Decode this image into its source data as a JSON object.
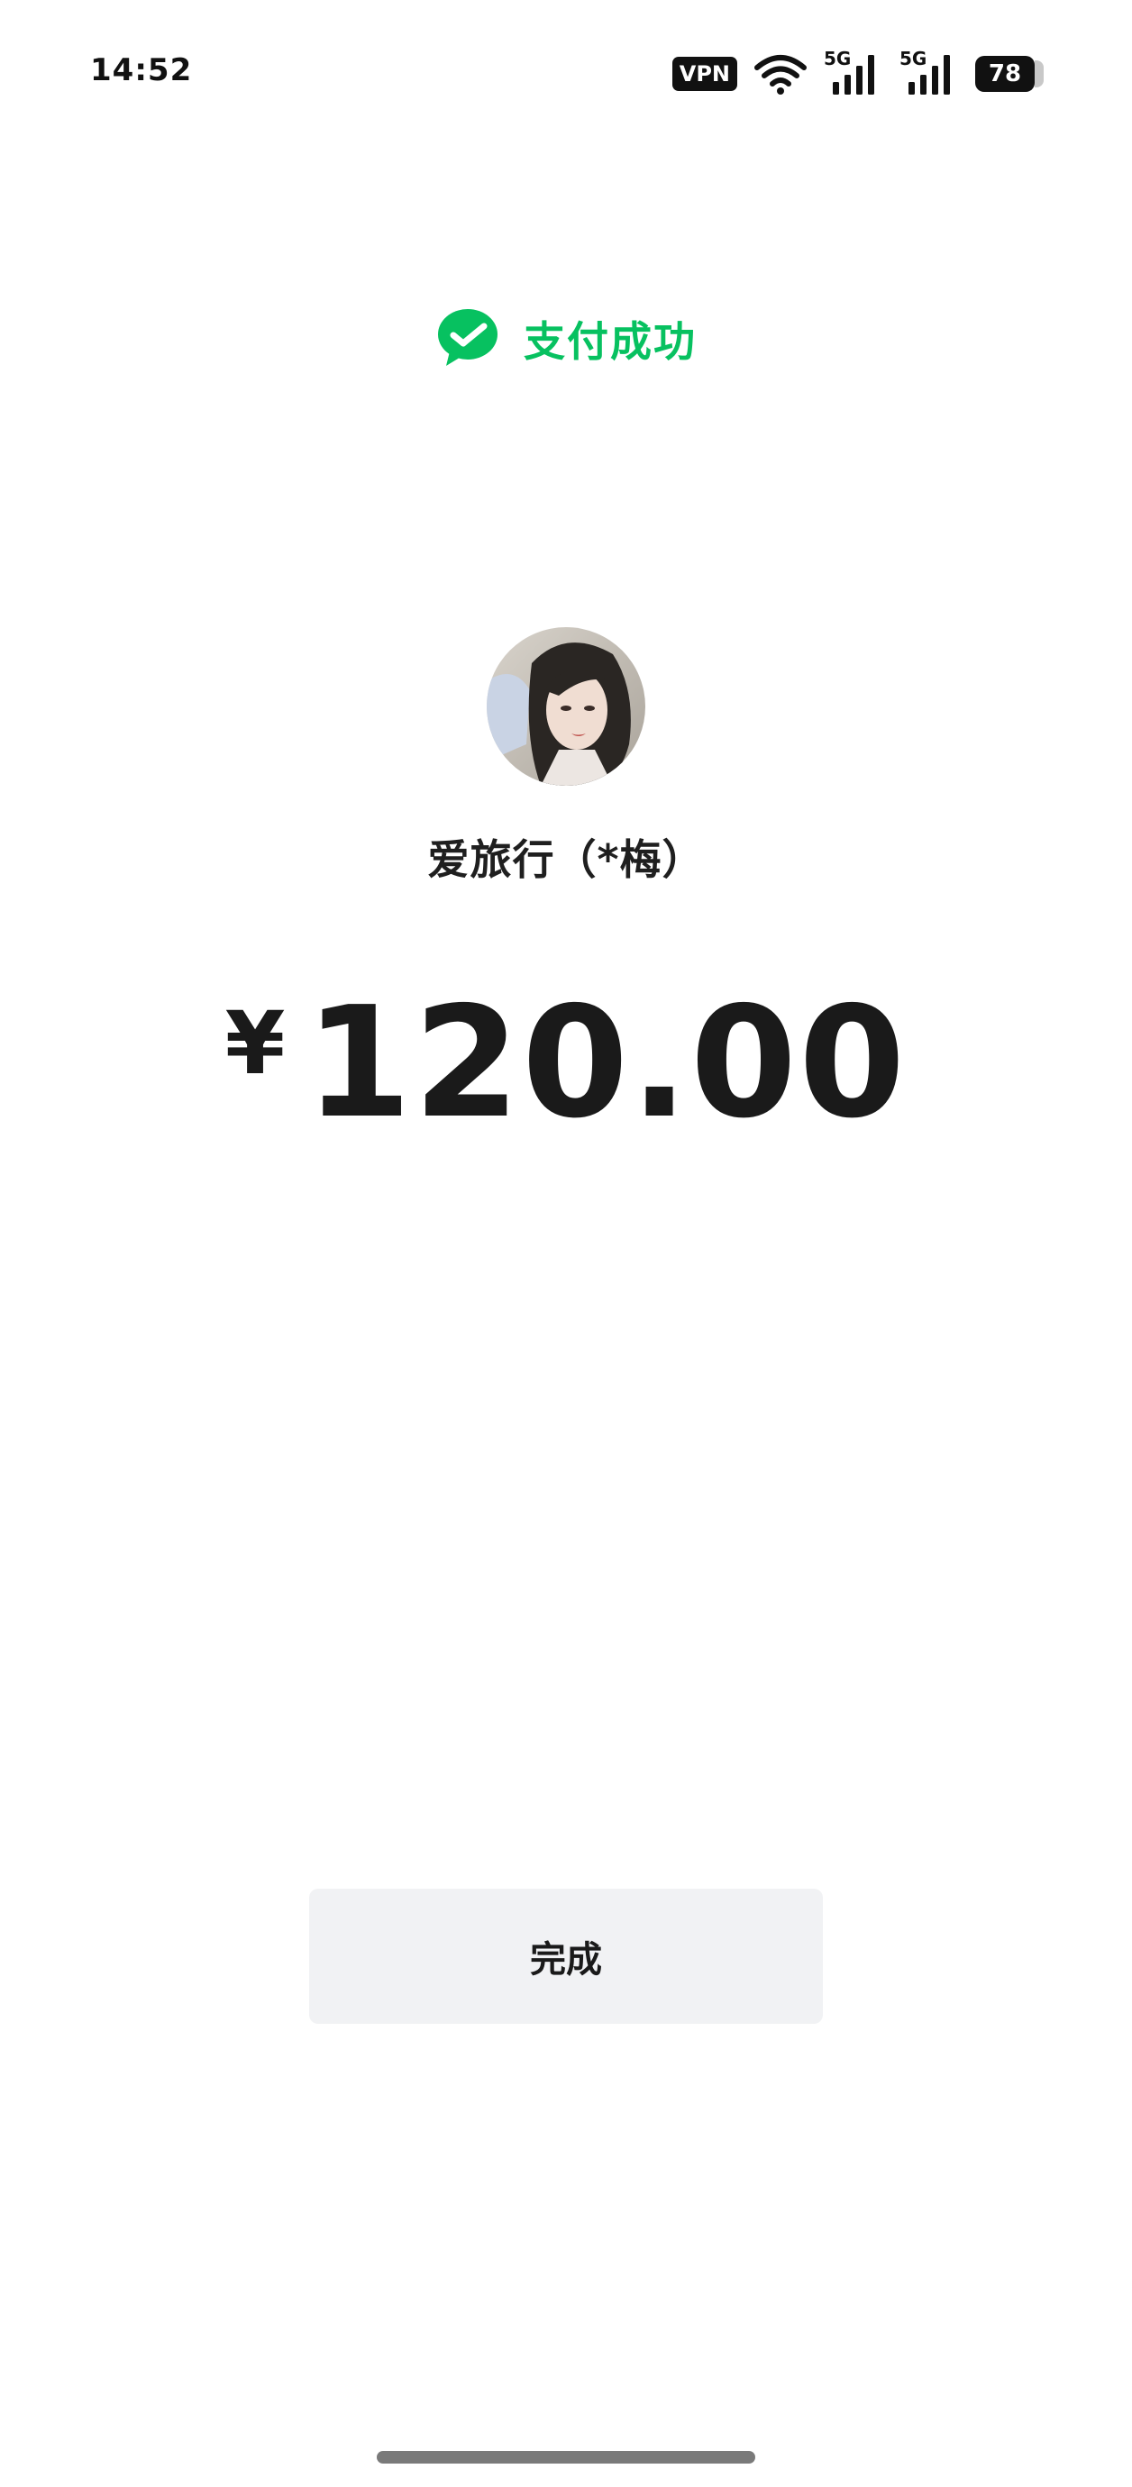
{
  "status_bar": {
    "time": "14:52",
    "vpn_label": "VPN",
    "signal1_label": "5G",
    "signal2_label": "5G",
    "battery_level": "78"
  },
  "header": {
    "title": "支付成功",
    "icon": "wechat-pay-check-icon",
    "accent_color": "#07c160"
  },
  "payee": {
    "name": "爱旅行（*梅）",
    "avatar": "avatar"
  },
  "payment": {
    "currency_symbol": "¥",
    "amount": "120.00"
  },
  "actions": {
    "done_label": "完成"
  }
}
